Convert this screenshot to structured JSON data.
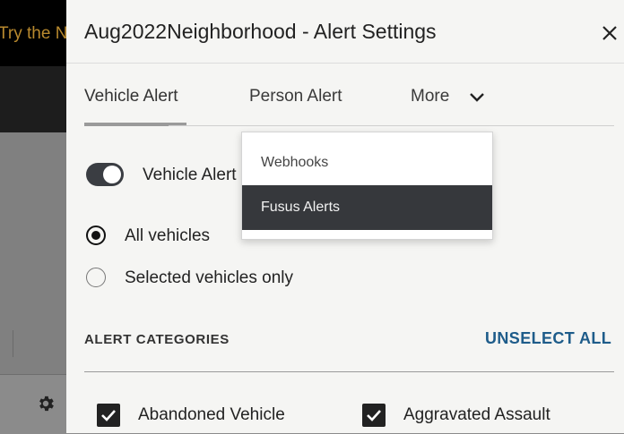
{
  "background": {
    "banner_text": "Try the Ne"
  },
  "modal": {
    "title": "Aug2022Neighborhood - Alert Settings",
    "tabs": [
      {
        "label": "Vehicle Alert",
        "active": true
      },
      {
        "label": "Person Alert",
        "active": false
      },
      {
        "label": "More",
        "active": false
      }
    ],
    "toggle": {
      "label": "Vehicle Alert",
      "on": true
    },
    "radios": [
      {
        "label": "All vehicles",
        "selected": true
      },
      {
        "label": "Selected vehicles only",
        "selected": false
      }
    ],
    "categories": {
      "heading": "ALERT CATEGORIES",
      "unselect_all": "UNSELECT ALL",
      "items": [
        {
          "label": "Abandoned Vehicle",
          "checked": true
        },
        {
          "label": "Aggravated Assault",
          "checked": true
        }
      ]
    }
  },
  "more_menu": {
    "items": [
      {
        "label": "Webhooks",
        "highlighted": false
      },
      {
        "label": "Fusus Alerts",
        "highlighted": true
      }
    ]
  },
  "colors": {
    "accent_link": "#1e5c8a",
    "toggle_on": "#3a3d42",
    "menu_highlight": "#36383c"
  }
}
